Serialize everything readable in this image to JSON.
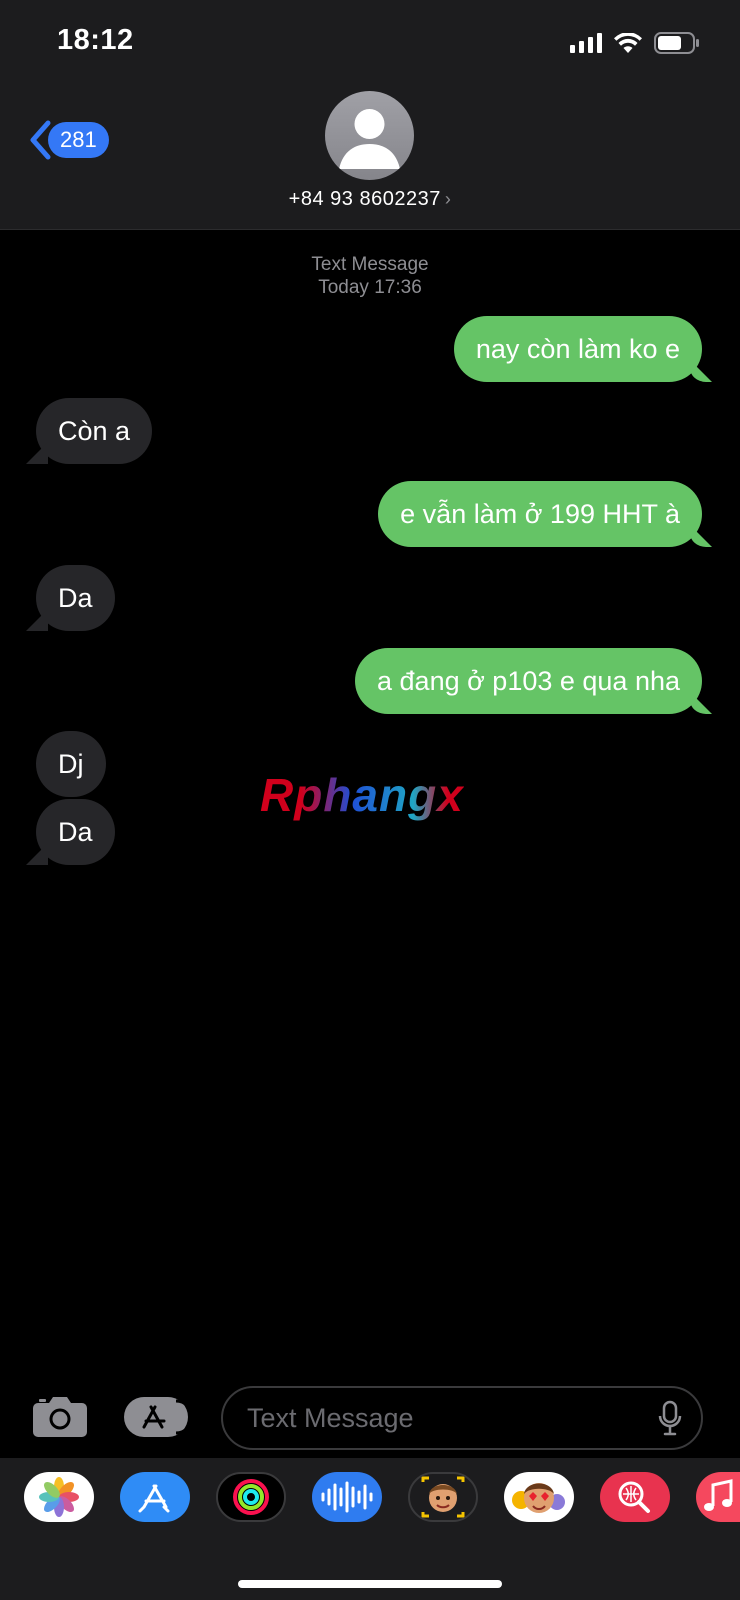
{
  "status_bar": {
    "time": "18:12"
  },
  "header": {
    "back_badge": "281",
    "contact": "+84 93 8602237"
  },
  "thread": {
    "service": "Text Message",
    "timestamp": "Today 17:36",
    "messages": [
      {
        "direction": "outgoing",
        "text": "nay còn làm ko e"
      },
      {
        "direction": "incoming",
        "text": "Còn a"
      },
      {
        "direction": "outgoing",
        "text": "e vẫn làm ở 199 HHT à"
      },
      {
        "direction": "incoming",
        "text": "Da"
      },
      {
        "direction": "outgoing",
        "text": "a đang ở p103 e qua nha"
      },
      {
        "direction": "incoming",
        "text": "Dj"
      },
      {
        "direction": "incoming",
        "text": "Da"
      }
    ]
  },
  "watermark": "Rphangx",
  "composer": {
    "placeholder": "Text Message"
  },
  "app_tray": {
    "apps": [
      "photos-icon",
      "app-store-icon",
      "activity-icon",
      "audio-message-icon",
      "memoji-icon",
      "animoji-stickers-icon",
      "image-search-icon",
      "music-icon"
    ]
  },
  "colors": {
    "outgoing_bubble": "#65c466",
    "incoming_bubble": "#262629",
    "accent": "#3478f6",
    "header_bg": "#1c1c1e"
  }
}
